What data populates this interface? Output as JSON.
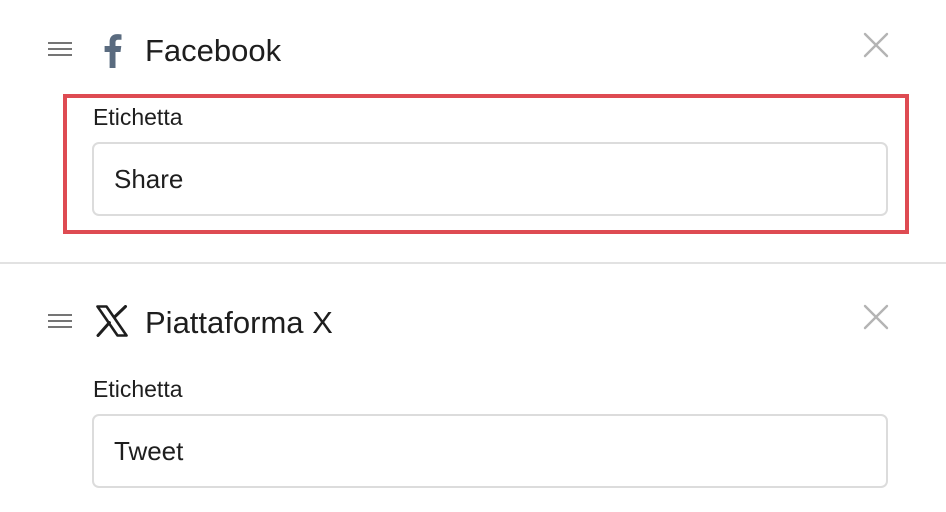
{
  "services": [
    {
      "icon": "facebook-icon",
      "title": "Facebook",
      "field_label": "Etichetta",
      "field_value": "Share",
      "icon_color": "#5a6b7f"
    },
    {
      "icon": "x-logo-icon",
      "title": "Piattaforma X",
      "field_label": "Etichetta",
      "field_value": "Tweet",
      "icon_color": "#1e1e1e"
    }
  ],
  "highlight_color": "#de4b52"
}
